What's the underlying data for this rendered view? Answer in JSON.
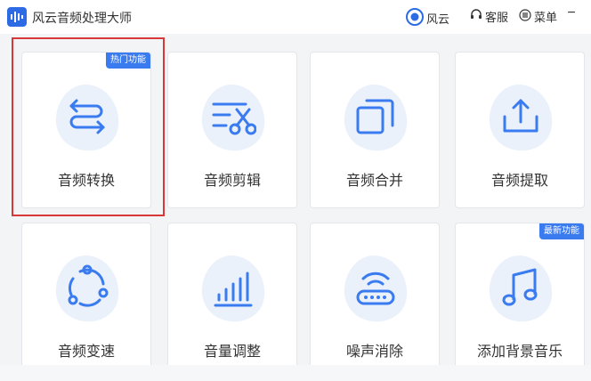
{
  "app": {
    "title": "风云音频处理大师"
  },
  "header": {
    "fengyun_label": "风云",
    "service_label": "客服",
    "menu_label": "菜单",
    "minimize_label": "−"
  },
  "accent_color": "#3a7bf0",
  "highlight_color": "#d9383a",
  "features": [
    {
      "label": "音频转换",
      "icon": "convert-arrows-icon",
      "badge": "热门功能"
    },
    {
      "label": "音频剪辑",
      "icon": "scissors-icon",
      "badge": null
    },
    {
      "label": "音频合并",
      "icon": "merge-squares-icon",
      "badge": null
    },
    {
      "label": "音频提取",
      "icon": "upload-tray-icon",
      "badge": null
    },
    {
      "label": "音频变速",
      "icon": "cycle-dots-icon",
      "badge": null
    },
    {
      "label": "音量调整",
      "icon": "volume-bars-icon",
      "badge": null
    },
    {
      "label": "噪声消除",
      "icon": "router-wave-icon",
      "badge": null
    },
    {
      "label": "添加背景音乐",
      "icon": "music-note-icon",
      "badge": "最新功能"
    }
  ]
}
